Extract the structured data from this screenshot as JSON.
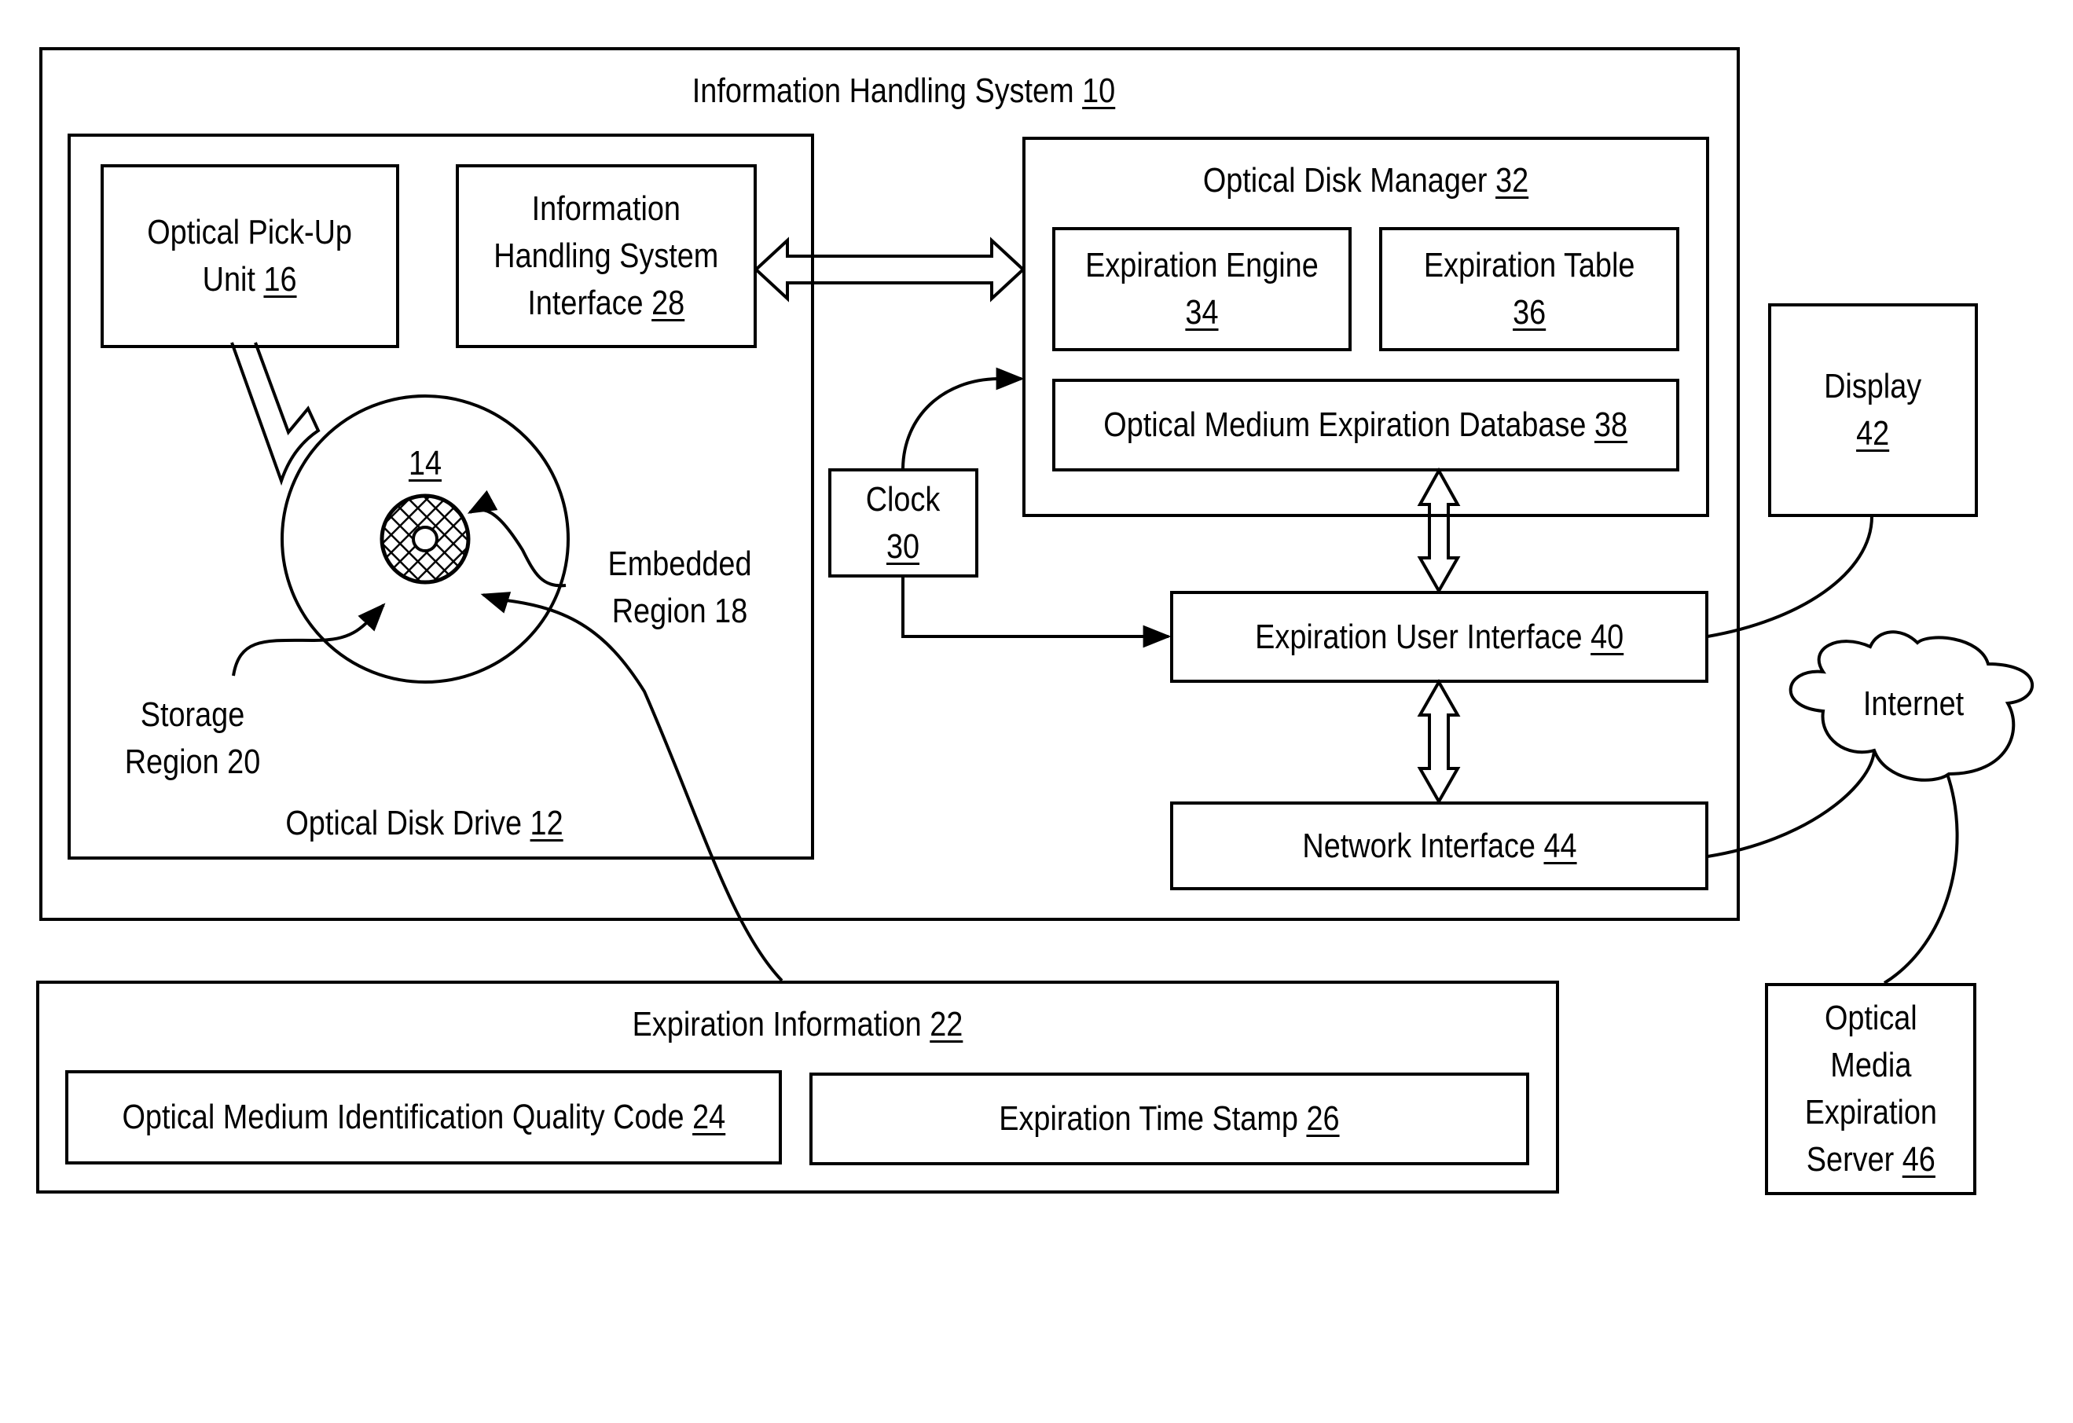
{
  "diagram": {
    "information_handling_system": {
      "label": "Information Handling System",
      "ref": "10"
    },
    "optical_disk_drive": {
      "label": "Optical Disk Drive",
      "ref": "12"
    },
    "optical_disk": {
      "ref": "14"
    },
    "optical_pickup_unit": {
      "line1": "Optical Pick-Up",
      "line2": "Unit",
      "ref": "16"
    },
    "embedded_region": {
      "line1": "Embedded",
      "line2": "Region 18"
    },
    "storage_region": {
      "line1": "Storage",
      "line2": "Region 20"
    },
    "ihs_interface": {
      "line1": "Information",
      "line2": "Handling System",
      "line3": "Interface",
      "ref": "28"
    },
    "optical_disk_manager": {
      "label": "Optical Disk Manager",
      "ref": "32"
    },
    "expiration_engine": {
      "label": "Expiration Engine",
      "ref": "34"
    },
    "expiration_table": {
      "label": "Expiration Table",
      "ref": "36"
    },
    "expiration_database": {
      "label": "Optical Medium Expiration Database",
      "ref": "38"
    },
    "clock": {
      "label": "Clock",
      "ref": "30"
    },
    "expiration_user_interface": {
      "label": "Expiration User Interface",
      "ref": "40"
    },
    "network_interface": {
      "label": "Network Interface",
      "ref": "44"
    },
    "display": {
      "label": "Display",
      "ref": "42"
    },
    "internet": {
      "label": "Internet"
    },
    "expiration_server": {
      "line1": "Optical",
      "line2": "Media",
      "line3": "Expiration",
      "line4": "Server",
      "ref": "46"
    },
    "expiration_information": {
      "label": "Expiration Information",
      "ref": "22"
    },
    "quality_code": {
      "label": "Optical Medium Identification Quality Code",
      "ref": "24"
    },
    "time_stamp": {
      "label": "Expiration Time Stamp",
      "ref": "26"
    }
  }
}
